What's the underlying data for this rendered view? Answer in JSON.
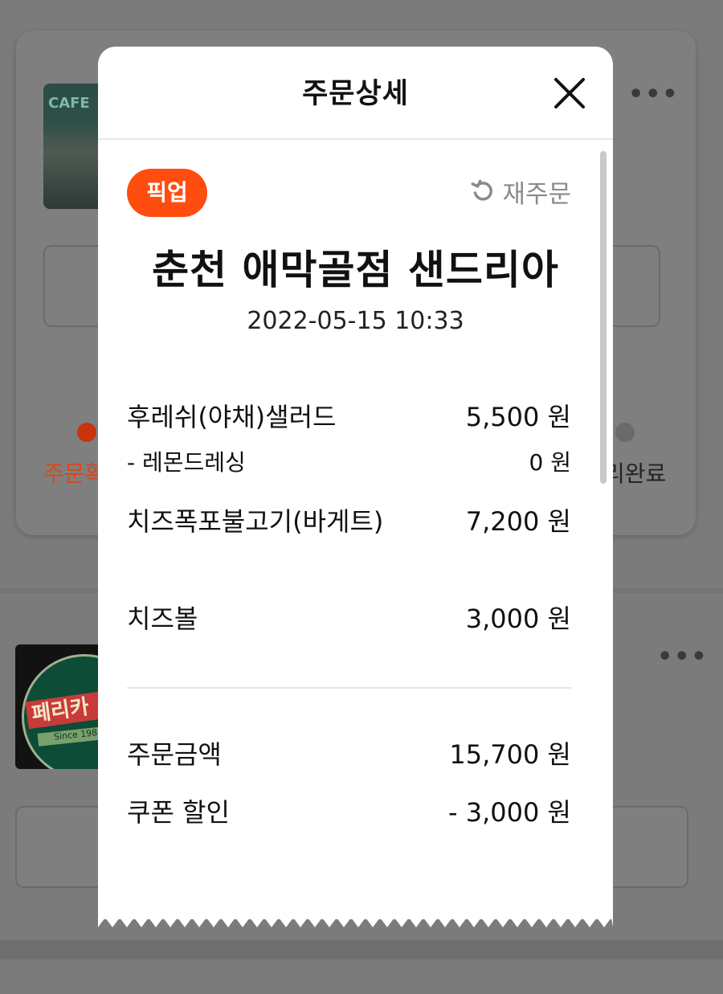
{
  "background": {
    "steps": [
      {
        "label": "주문확",
        "color": "#d9471a",
        "dot": "#c8340c"
      },
      {
        "label": "리완료",
        "color": "#222222",
        "dot": "#6a6a6a"
      }
    ],
    "thumb1_text": "CAFE",
    "thumb2_text": "페리카",
    "thumb2_since": "Since 198"
  },
  "modal": {
    "title": "주문상세",
    "badge": "픽업",
    "reorder_label": "재주문",
    "store_name": "춘천 애막골점 샌드리아",
    "order_datetime": "2022-05-15 10:33",
    "items": [
      {
        "name": "후레쉬(야채)샐러드",
        "price": "5,500 원"
      },
      {
        "name": "- 레몬드레싱",
        "price": "0 원"
      },
      {
        "name": "치즈폭포불고기(바게트)",
        "price": "7,200 원"
      },
      {
        "name": "치즈볼",
        "price": "3,000 원"
      }
    ],
    "summary": [
      {
        "name": "주문금액",
        "price": "15,700 원"
      },
      {
        "name": "쿠폰 할인",
        "price": "- 3,000 원"
      }
    ]
  },
  "colors": {
    "accent": "#ff4d0f",
    "overlay": "#7b7b7b"
  },
  "icons": {
    "close": "close-icon",
    "reorder": "refresh-icon",
    "more": "more-horizontal-icon"
  }
}
